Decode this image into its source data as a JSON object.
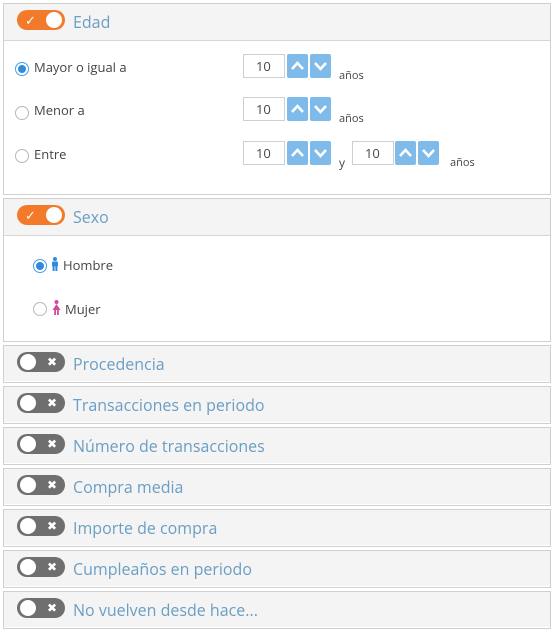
{
  "edad": {
    "title": "Edad",
    "toggle_mark": "✓",
    "rows": [
      {
        "label": "Mayor o igual a",
        "value": "10",
        "unit": "años"
      },
      {
        "label": "Menor a",
        "value": "10",
        "unit": "años"
      },
      {
        "label": "Entre",
        "value_from": "10",
        "connector": "y",
        "value_to": "10",
        "unit": "años"
      }
    ]
  },
  "sexo": {
    "title": "Sexo",
    "toggle_mark": "✓",
    "options": [
      {
        "label": "Hombre",
        "icon": "male-icon",
        "color": "#2d8ce0"
      },
      {
        "label": "Mujer",
        "icon": "female-icon",
        "color": "#d04aa0"
      }
    ]
  },
  "collapsed": [
    {
      "title": "Procedencia"
    },
    {
      "title": "Transacciones en periodo"
    },
    {
      "title": "Número de transacciones"
    },
    {
      "title": "Compra media"
    },
    {
      "title": "Importe de compra"
    },
    {
      "title": "Cumpleaños en periodo"
    },
    {
      "title": "No vuelven desde hace..."
    }
  ],
  "toggle_off_mark": "✖",
  "colors": {
    "accent_on": "#f47a2b",
    "toggle_off": "#6f6f6f",
    "title": "#6a9ec4",
    "stepper": "#7fbbea",
    "radio_checked": "#2d8ce0"
  }
}
